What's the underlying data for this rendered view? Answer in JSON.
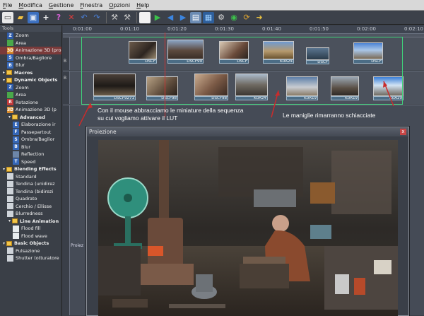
{
  "menu": [
    "File",
    "Modifica",
    "Gestione",
    "Finestra",
    "Opzioni",
    "Help"
  ],
  "toolbar": {
    "icons": [
      "new-icon",
      "open-icon",
      "save-icon",
      "add-icon",
      "help-icon",
      "delete-icon",
      "undo-icon",
      "redo-icon",
      "wrench-icon",
      "wrench-icon",
      "stop-icon",
      "play-icon",
      "prev-icon",
      "next-icon",
      "film-icon",
      "screen-icon",
      "settings-icon",
      "record-icon",
      "refresh-icon",
      "export-icon"
    ]
  },
  "tools": {
    "title": "Tools",
    "items": [
      {
        "label": "Zoom",
        "icon": "Z",
        "color": "#2d5aa8",
        "level": 1,
        "type": "item"
      },
      {
        "label": "Area",
        "icon": "",
        "color": "#4aa84a",
        "level": 1,
        "type": "item"
      },
      {
        "label": "Animazione 3D (pro",
        "icon": "3D",
        "color": "#d7892a",
        "level": 1,
        "type": "item",
        "selected": true
      },
      {
        "label": "Ombra/Bagliore",
        "icon": "S",
        "color": "#3567b8",
        "level": 1,
        "type": "item"
      },
      {
        "label": "Blur",
        "icon": "B",
        "color": "#3567b8",
        "level": 1,
        "type": "item"
      },
      {
        "label": "Macros",
        "level": 0,
        "type": "group",
        "exp": "▸"
      },
      {
        "label": "Dynamic Objects",
        "level": 0,
        "type": "group",
        "exp": "▾"
      },
      {
        "label": "Zoom",
        "icon": "Z",
        "color": "#2d5aa8",
        "level": 1,
        "type": "item"
      },
      {
        "label": "Area",
        "icon": "",
        "color": "#4aa84a",
        "level": 1,
        "type": "item"
      },
      {
        "label": "Rotazione",
        "icon": "R",
        "color": "#c23a3a",
        "level": 1,
        "type": "item"
      },
      {
        "label": "Animazione 3D (p",
        "icon": "3D",
        "color": "#d7892a",
        "level": 1,
        "type": "item"
      },
      {
        "label": "Advanced",
        "level": 1,
        "type": "group",
        "exp": "▾"
      },
      {
        "label": "Elaborazione ir",
        "icon": "E",
        "color": "#3567b8",
        "level": 2,
        "type": "item"
      },
      {
        "label": "Passepartout",
        "icon": "F",
        "color": "#3567b8",
        "level": 2,
        "type": "item"
      },
      {
        "label": "Ombra/Baglior",
        "icon": "S",
        "color": "#3567b8",
        "level": 2,
        "type": "item"
      },
      {
        "label": "Blur",
        "icon": "B",
        "color": "#3567b8",
        "level": 2,
        "type": "item"
      },
      {
        "label": "Reflection",
        "icon": "",
        "color": "#6d86a8",
        "level": 2,
        "type": "item"
      },
      {
        "label": "Speed",
        "icon": "T",
        "color": "#3567b8",
        "level": 2,
        "type": "item"
      },
      {
        "label": "Blending Effects",
        "level": 0,
        "type": "group",
        "exp": "▾"
      },
      {
        "label": "Standard",
        "icon": "",
        "color": "#cfd4da",
        "level": 1,
        "type": "item"
      },
      {
        "label": "Tendina (unidirez",
        "icon": "",
        "color": "#cfd4da",
        "level": 1,
        "type": "item"
      },
      {
        "label": "Tendina (bidirezi",
        "icon": "",
        "color": "#cfd4da",
        "level": 1,
        "type": "item"
      },
      {
        "label": "Quadrato",
        "icon": "",
        "color": "#cfd4da",
        "level": 1,
        "type": "item"
      },
      {
        "label": "Cerchio / Ellisse",
        "icon": "",
        "color": "#cfd4da",
        "level": 1,
        "type": "item"
      },
      {
        "label": "Blurredness",
        "icon": "",
        "color": "#cfd4da",
        "level": 1,
        "type": "item"
      },
      {
        "label": "Line Animation",
        "level": 1,
        "type": "group",
        "exp": "▾"
      },
      {
        "label": "Flood fill",
        "icon": "",
        "color": "#e8ecef",
        "level": 2,
        "type": "item"
      },
      {
        "label": "Flood wave",
        "icon": "",
        "color": "#e8ecef",
        "level": 2,
        "type": "item"
      },
      {
        "label": "Basic Objects",
        "level": 0,
        "type": "group",
        "exp": "▾"
      },
      {
        "label": "Pulsazione",
        "icon": "",
        "color": "#cfd4da",
        "level": 1,
        "type": "item"
      },
      {
        "label": "Shutter (otturatore",
        "icon": "",
        "color": "#cfd4da",
        "level": 1,
        "type": "item"
      }
    ]
  },
  "ruler": [
    "0:01:00",
    "0:01:10",
    "0:01:20",
    "0:01:30",
    "0:01:40",
    "0:01:50",
    "0:02:00",
    "0:02:10"
  ],
  "track_labels": [
    "B",
    "B"
  ],
  "clips_row1": [
    "DSCF",
    "DSCF99",
    "DSCF",
    "K0A24",
    "DSCF",
    "DSCF"
  ],
  "clips_row2": [
    "DSCF9271",
    "DSCF98",
    "DSCF98",
    "K0A24",
    "K0A19",
    "K0A19",
    "K0A29"
  ],
  "annotations": {
    "left": "Con il mouse abbracciamo le miniature della sequenza su cui vogliamo attivare il LUT",
    "right": "Le maniglie rimarranno schiacciate"
  },
  "projection": {
    "title": "Proiezione",
    "close": "x"
  },
  "side_tab": "Proiez"
}
